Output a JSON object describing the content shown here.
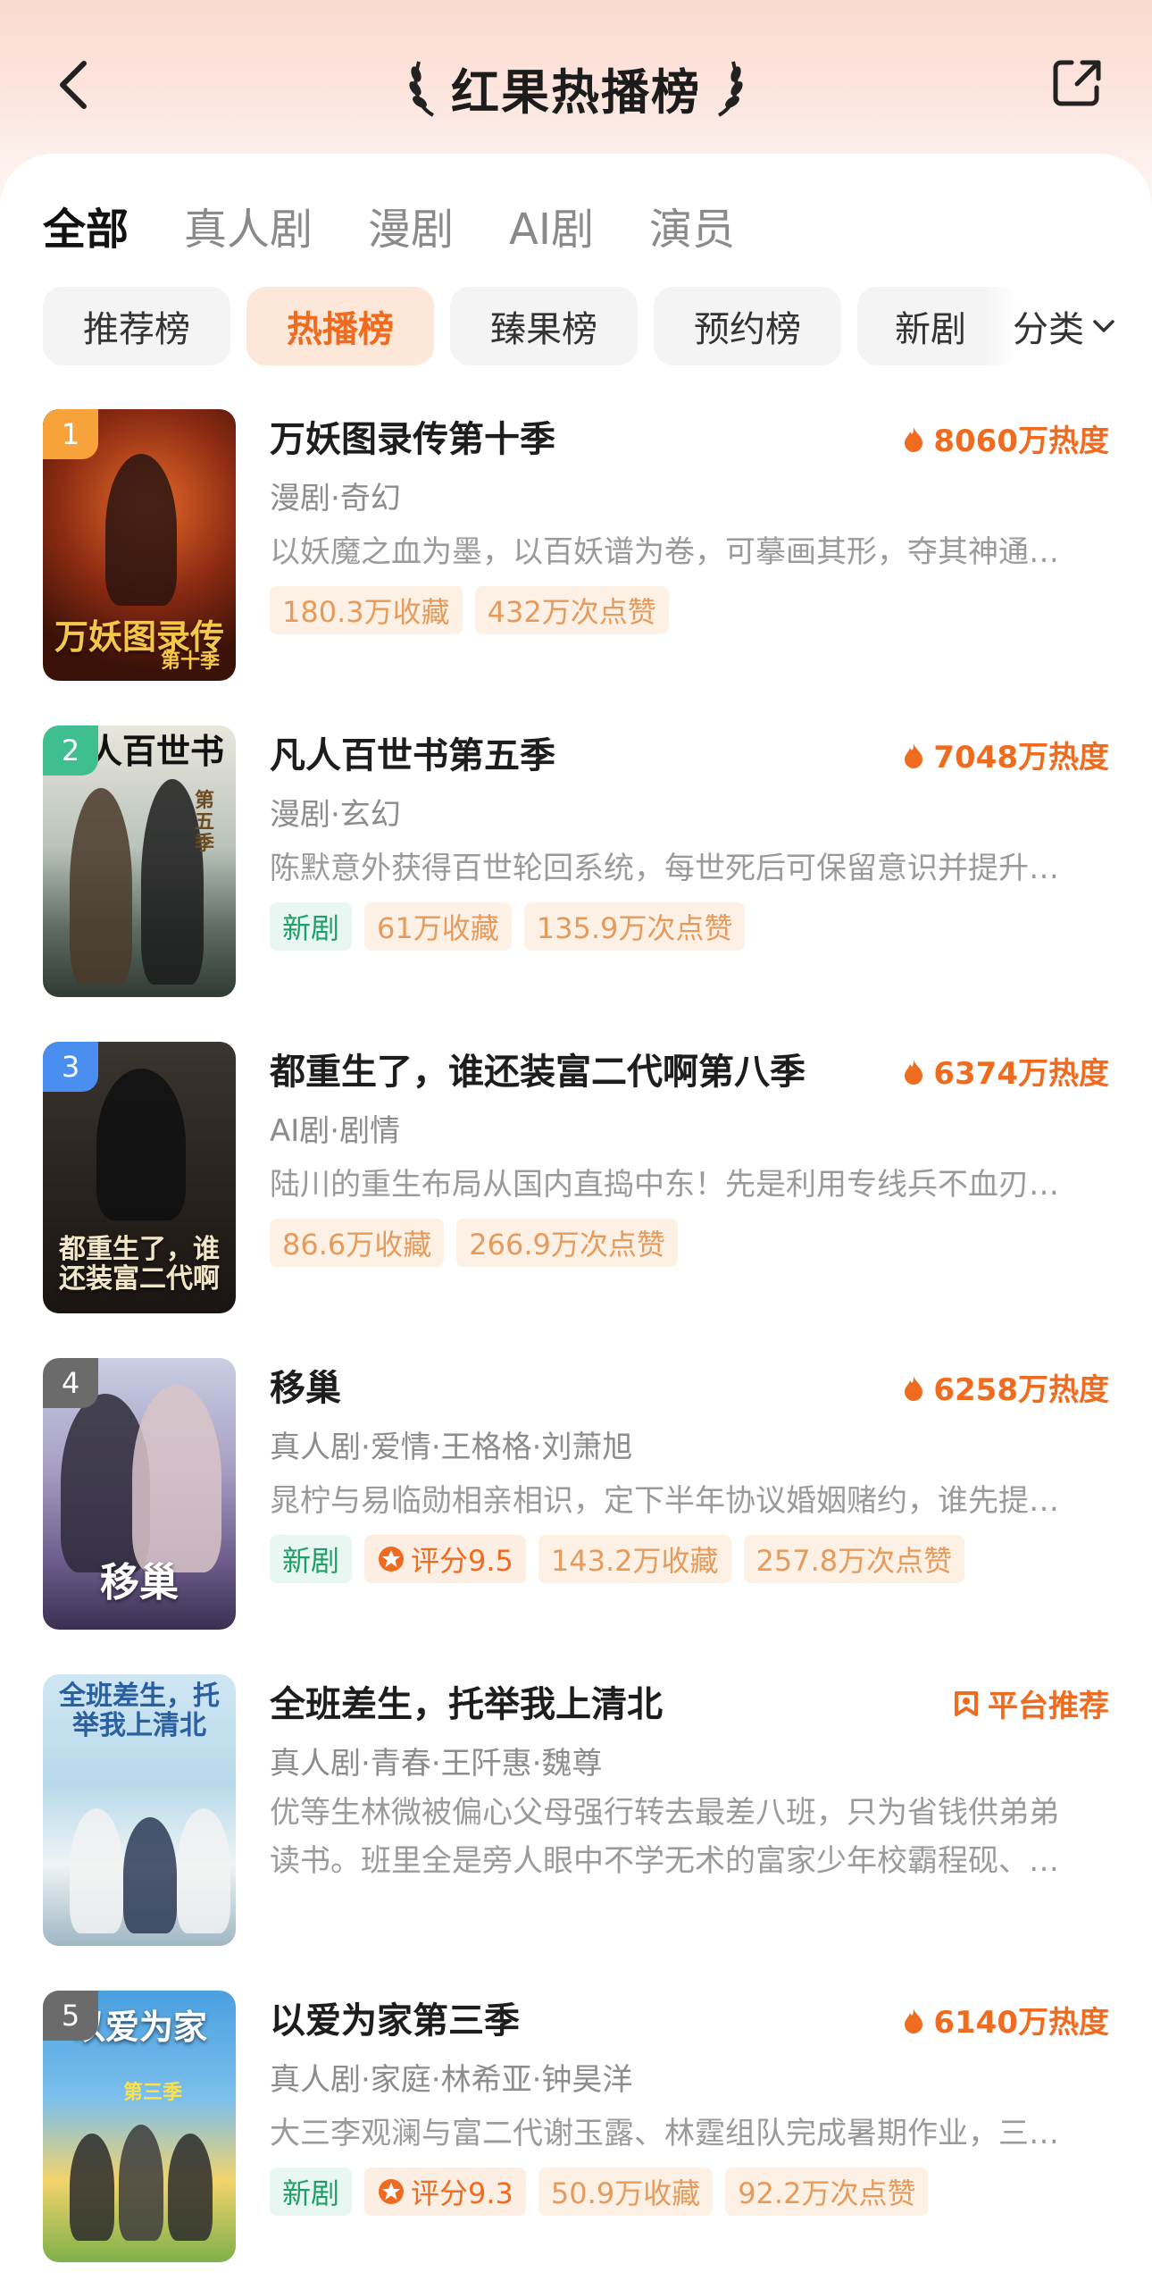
{
  "header": {
    "title": "红果热播榜"
  },
  "tabs": [
    {
      "label": "全部",
      "active": true
    },
    {
      "label": "真人剧",
      "active": false
    },
    {
      "label": "漫剧",
      "active": false
    },
    {
      "label": "AI剧",
      "active": false
    },
    {
      "label": "演员",
      "active": false
    }
  ],
  "chips": [
    {
      "label": "推荐榜",
      "active": false
    },
    {
      "label": "热播榜",
      "active": true
    },
    {
      "label": "臻果榜",
      "active": false
    },
    {
      "label": "预约榜",
      "active": false
    },
    {
      "label": "新剧",
      "active": false
    }
  ],
  "category_label": "分类",
  "colors": {
    "accent": "#ef6b1f",
    "new_tag": "#1f9e6a",
    "rank1": "#f7a33a",
    "rank2": "#3fbf8f",
    "rank3": "#4a8ff0",
    "rank_other": "#6b6b6b"
  },
  "items": [
    {
      "rank": "1",
      "poster_title": "万妖图录传",
      "poster_sub": "第十季",
      "name": "万妖图录传第十季",
      "heat": "8060万热度",
      "meta": "漫剧·奇幻",
      "desc": "以妖魔之血为墨，以百妖谱为卷，可摹画其形，夺其神通…",
      "tags": [
        "180.3万收藏",
        "432万次点赞"
      ]
    },
    {
      "rank": "2",
      "poster_title": "凡人百世书",
      "poster_sub": "第五季",
      "name": "凡人百世书第五季",
      "heat": "7048万热度",
      "meta": "漫剧·玄幻",
      "desc": "陈默意外获得百世轮回系统，每世死后可保留意识并提升…",
      "new_tag": "新剧",
      "tags": [
        "61万收藏",
        "135.9万次点赞"
      ]
    },
    {
      "rank": "3",
      "poster_title": "都重生了，谁还装富二代啊",
      "name": "都重生了，谁还装富二代啊第八季",
      "heat": "6374万热度",
      "meta": "AI剧·剧情",
      "desc": "陆川的重生布局从国内直捣中东！先是利用专线兵不血刃…",
      "tags": [
        "86.6万收藏",
        "266.9万次点赞"
      ]
    },
    {
      "rank": "4",
      "poster_title": "移巢",
      "name": "移巢",
      "heat": "6258万热度",
      "meta": "真人剧·爱情·王格格·刘萧旭",
      "desc": "晁柠与易临勋相亲相识，定下半年协议婚姻赌约，谁先提…",
      "new_tag": "新剧",
      "score": "评分9.5",
      "tags": [
        "143.2万收藏",
        "257.8万次点赞"
      ]
    },
    {
      "poster_title": "全班差生，托举我上清北",
      "name": "全班差生，托举我上清北",
      "recommend": "平台推荐",
      "meta": "真人剧·青春·王阡惠·魏尊",
      "desc_line1": "优等生林微被偏心父母强行转去最差八班，只为省钱供弟弟",
      "desc_line2": "读书。班里全是旁人眼中不学无术的富家少年校霸程砚、…"
    },
    {
      "rank": "5",
      "poster_title": "以爱为家",
      "poster_sub": "第三季",
      "name": "以爱为家第三季",
      "heat": "6140万热度",
      "meta": "真人剧·家庭·林希亚·钟昊洋",
      "desc": "大三李观澜与富二代谢玉露、林霆组队完成暑期作业，三…",
      "new_tag": "新剧",
      "score": "评分9.3",
      "tags": [
        "50.9万收藏",
        "92.2万次点赞"
      ]
    }
  ]
}
